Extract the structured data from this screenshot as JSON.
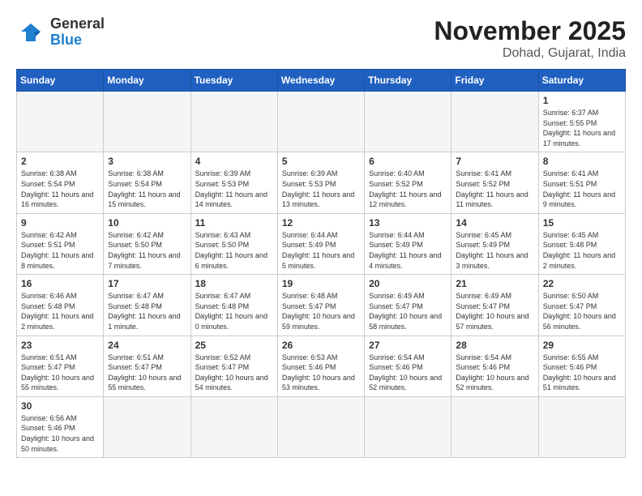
{
  "header": {
    "logo_general": "General",
    "logo_blue": "Blue",
    "month_title": "November 2025",
    "location": "Dohad, Gujarat, India"
  },
  "weekdays": [
    "Sunday",
    "Monday",
    "Tuesday",
    "Wednesday",
    "Thursday",
    "Friday",
    "Saturday"
  ],
  "days": {
    "1": {
      "sunrise": "6:37 AM",
      "sunset": "5:55 PM",
      "daylight": "11 hours and 17 minutes."
    },
    "2": {
      "sunrise": "6:38 AM",
      "sunset": "5:54 PM",
      "daylight": "11 hours and 16 minutes."
    },
    "3": {
      "sunrise": "6:38 AM",
      "sunset": "5:54 PM",
      "daylight": "11 hours and 15 minutes."
    },
    "4": {
      "sunrise": "6:39 AM",
      "sunset": "5:53 PM",
      "daylight": "11 hours and 14 minutes."
    },
    "5": {
      "sunrise": "6:39 AM",
      "sunset": "5:53 PM",
      "daylight": "11 hours and 13 minutes."
    },
    "6": {
      "sunrise": "6:40 AM",
      "sunset": "5:52 PM",
      "daylight": "11 hours and 12 minutes."
    },
    "7": {
      "sunrise": "6:41 AM",
      "sunset": "5:52 PM",
      "daylight": "11 hours and 11 minutes."
    },
    "8": {
      "sunrise": "6:41 AM",
      "sunset": "5:51 PM",
      "daylight": "11 hours and 9 minutes."
    },
    "9": {
      "sunrise": "6:42 AM",
      "sunset": "5:51 PM",
      "daylight": "11 hours and 8 minutes."
    },
    "10": {
      "sunrise": "6:42 AM",
      "sunset": "5:50 PM",
      "daylight": "11 hours and 7 minutes."
    },
    "11": {
      "sunrise": "6:43 AM",
      "sunset": "5:50 PM",
      "daylight": "11 hours and 6 minutes."
    },
    "12": {
      "sunrise": "6:44 AM",
      "sunset": "5:49 PM",
      "daylight": "11 hours and 5 minutes."
    },
    "13": {
      "sunrise": "6:44 AM",
      "sunset": "5:49 PM",
      "daylight": "11 hours and 4 minutes."
    },
    "14": {
      "sunrise": "6:45 AM",
      "sunset": "5:49 PM",
      "daylight": "11 hours and 3 minutes."
    },
    "15": {
      "sunrise": "6:45 AM",
      "sunset": "5:48 PM",
      "daylight": "11 hours and 2 minutes."
    },
    "16": {
      "sunrise": "6:46 AM",
      "sunset": "5:48 PM",
      "daylight": "11 hours and 2 minutes."
    },
    "17": {
      "sunrise": "6:47 AM",
      "sunset": "5:48 PM",
      "daylight": "11 hours and 1 minute."
    },
    "18": {
      "sunrise": "6:47 AM",
      "sunset": "5:48 PM",
      "daylight": "11 hours and 0 minutes."
    },
    "19": {
      "sunrise": "6:48 AM",
      "sunset": "5:47 PM",
      "daylight": "10 hours and 59 minutes."
    },
    "20": {
      "sunrise": "6:49 AM",
      "sunset": "5:47 PM",
      "daylight": "10 hours and 58 minutes."
    },
    "21": {
      "sunrise": "6:49 AM",
      "sunset": "5:47 PM",
      "daylight": "10 hours and 57 minutes."
    },
    "22": {
      "sunrise": "6:50 AM",
      "sunset": "5:47 PM",
      "daylight": "10 hours and 56 minutes."
    },
    "23": {
      "sunrise": "6:51 AM",
      "sunset": "5:47 PM",
      "daylight": "10 hours and 55 minutes."
    },
    "24": {
      "sunrise": "6:51 AM",
      "sunset": "5:47 PM",
      "daylight": "10 hours and 55 minutes."
    },
    "25": {
      "sunrise": "6:52 AM",
      "sunset": "5:47 PM",
      "daylight": "10 hours and 54 minutes."
    },
    "26": {
      "sunrise": "6:53 AM",
      "sunset": "5:46 PM",
      "daylight": "10 hours and 53 minutes."
    },
    "27": {
      "sunrise": "6:54 AM",
      "sunset": "5:46 PM",
      "daylight": "10 hours and 52 minutes."
    },
    "28": {
      "sunrise": "6:54 AM",
      "sunset": "5:46 PM",
      "daylight": "10 hours and 52 minutes."
    },
    "29": {
      "sunrise": "6:55 AM",
      "sunset": "5:46 PM",
      "daylight": "10 hours and 51 minutes."
    },
    "30": {
      "sunrise": "6:56 AM",
      "sunset": "5:46 PM",
      "daylight": "10 hours and 50 minutes."
    }
  }
}
